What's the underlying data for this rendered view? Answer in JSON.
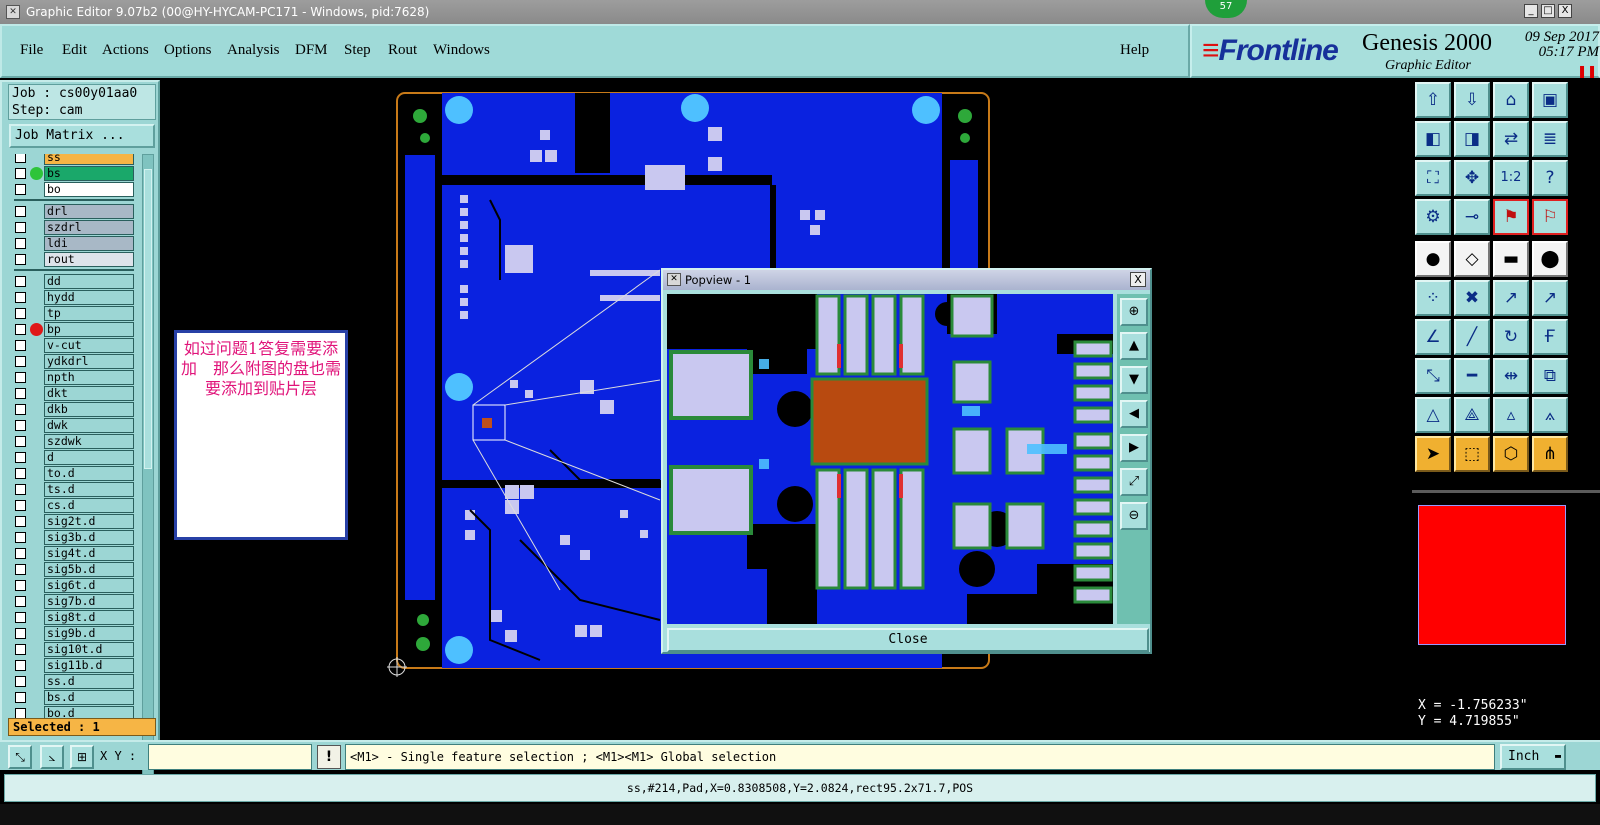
{
  "window": {
    "title": "Graphic Editor 9.07b2 (00@HY-HYCAM-PC171 - Windows, pid:7628)",
    "notification_count": "57",
    "min": "_",
    "max": "□",
    "close": "X"
  },
  "menu": [
    "File",
    "Edit",
    "Actions",
    "Options",
    "Analysis",
    "DFM",
    "Step",
    "Rout",
    "Windows"
  ],
  "help": "Help",
  "brand": {
    "logo": "Frontline",
    "product": "Genesis 2000",
    "subtitle": "Graphic Editor",
    "date": "09 Sep 2017",
    "time": "05:17 PM"
  },
  "job": {
    "job_line": "Job : cs00y01aa0",
    "step_line": "Step: cam",
    "matrix_button": "Job Matrix ..."
  },
  "layers_group1": [
    {
      "name": "ss",
      "bg": "#f6b545",
      "dot": ""
    },
    {
      "name": "bs",
      "bg": "#1aa86a",
      "dot": "#2ec43a"
    },
    {
      "name": "bo",
      "bg": "#ffffff",
      "dot": ""
    }
  ],
  "layers_group2": [
    {
      "name": "drl",
      "bg": "#a8b8c6"
    },
    {
      "name": "szdrl",
      "bg": "#a8b8c6"
    },
    {
      "name": "ldi",
      "bg": "#a8b8c6"
    },
    {
      "name": "rout",
      "bg": "#dde3ea"
    }
  ],
  "layers_group3": [
    {
      "name": "dd",
      "dot": ""
    },
    {
      "name": "hydd",
      "dot": ""
    },
    {
      "name": "tp",
      "dot": ""
    },
    {
      "name": "bp",
      "dot": "#e01818"
    },
    {
      "name": "v-cut",
      "dot": ""
    },
    {
      "name": "ydkdrl",
      "dot": ""
    },
    {
      "name": "npth",
      "dot": ""
    },
    {
      "name": "dkt",
      "dot": ""
    },
    {
      "name": "dkb",
      "dot": ""
    },
    {
      "name": "dwk",
      "dot": ""
    },
    {
      "name": "szdwk",
      "dot": ""
    },
    {
      "name": "d",
      "dot": ""
    },
    {
      "name": "to.d",
      "dot": ""
    },
    {
      "name": "ts.d",
      "dot": ""
    },
    {
      "name": "cs.d",
      "dot": ""
    },
    {
      "name": "sig2t.d",
      "dot": ""
    },
    {
      "name": "sig3b.d",
      "dot": ""
    },
    {
      "name": "sig4t.d",
      "dot": ""
    },
    {
      "name": "sig5b.d",
      "dot": ""
    },
    {
      "name": "sig6t.d",
      "dot": ""
    },
    {
      "name": "sig7b.d",
      "dot": ""
    },
    {
      "name": "sig8t.d",
      "dot": ""
    },
    {
      "name": "sig9b.d",
      "dot": ""
    },
    {
      "name": "sig10t.d",
      "dot": ""
    },
    {
      "name": "sig11b.d",
      "dot": ""
    },
    {
      "name": "ss.d",
      "dot": ""
    },
    {
      "name": "bs.d",
      "dot": ""
    },
    {
      "name": "bo.d",
      "dot": ""
    }
  ],
  "selected": "Selected : 1",
  "note": "如过问题1答复需要添加　那么附图的盘也需要添加到贴片层",
  "popview": {
    "title": "Popview - 1",
    "close_button": "Close",
    "close_x": "X"
  },
  "coords": {
    "x": "X = -1.756233\"",
    "y": "Y = 4.719855\""
  },
  "bottom": {
    "xy_label": "X Y :",
    "xy_value": "",
    "warn": "!",
    "help_text": "<M1> - Single feature selection ; <M1><M1> Global selection",
    "units": "Inch"
  },
  "status": "ss,#214,Pad,X=0.8308508,Y=2.0824,rect95.2x71.7,POS",
  "colors": {
    "teal": "#9cd6d4",
    "board_blue": "#0a22e0",
    "pad": "#c9c8f0",
    "accent": "#f6b545"
  }
}
